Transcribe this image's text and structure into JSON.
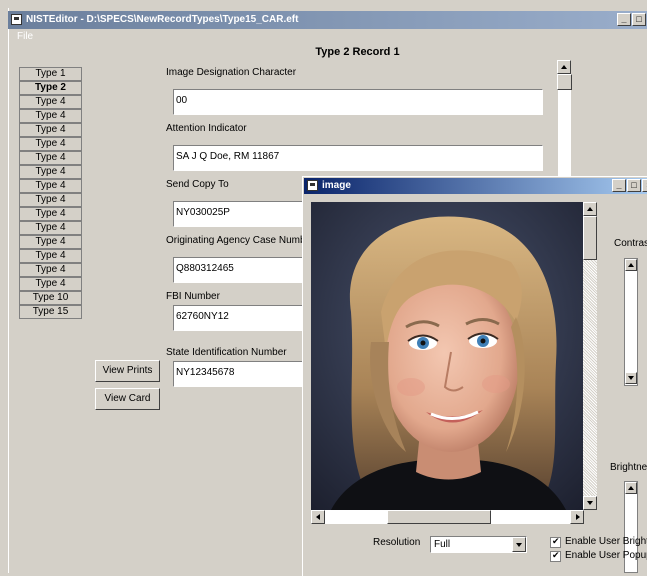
{
  "window": {
    "title": "NISTEditor - D:\\SPECS\\NewRecordTypes\\Type15_CAR.eft",
    "menu_file": "File",
    "min": "_",
    "max": "□",
    "close": "×"
  },
  "record_title": "Type 2 Record 1",
  "types": [
    "Type 1",
    "Type 2",
    "Type 4",
    "Type 4",
    "Type 4",
    "Type 4",
    "Type 4",
    "Type 4",
    "Type 4",
    "Type 4",
    "Type 4",
    "Type 4",
    "Type 4",
    "Type 4",
    "Type 4",
    "Type 4",
    "Type 10",
    "Type 15"
  ],
  "fields": {
    "idc": {
      "label": "Image Designation Character",
      "value": "00"
    },
    "attention": {
      "label": "Attention Indicator",
      "value": "SA J Q Doe, RM 11867"
    },
    "send_copy": {
      "label": "Send Copy To",
      "value": "NY030025P"
    },
    "case_number": {
      "label": "Originating Agency Case Numbe",
      "value": "Q880312465"
    },
    "fbi": {
      "label": "FBI Number",
      "value": "62760NY12"
    },
    "state_id": {
      "label": "State Identification Number",
      "value": "NY12345678"
    }
  },
  "buttons": {
    "view_prints": "View Prints",
    "view_card": "View Card"
  },
  "image_window": {
    "title": "image",
    "contrast_label": "Contras",
    "brightness_label": "Brightnes",
    "resolution_label": "Resolution",
    "resolution_value": "Full",
    "enable_brightness": "Enable User Brightn",
    "enable_popup": "Enable User Popup"
  }
}
